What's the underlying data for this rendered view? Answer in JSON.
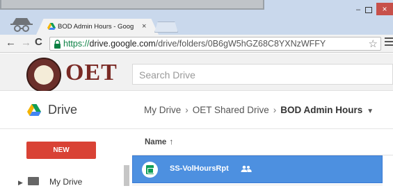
{
  "browser": {
    "tab_title": "BOD Admin Hours - Goog",
    "tab_close": "×",
    "window_min": "–",
    "window_close": "×",
    "url_scheme": "https://",
    "url_host": "drive.google.com",
    "url_path": "/drive/folders/0B6gW5hGZ68C8YXNzWFFY",
    "star": "☆"
  },
  "drive": {
    "logo_text": "OET",
    "search_placeholder": "Search Drive",
    "app_label": "Drive",
    "breadcrumb": [
      "My Drive",
      "OET Shared Drive",
      "BOD Admin Hours"
    ],
    "breadcrumb_sep": "›",
    "new_button": "NEW",
    "sidebar_items": [
      {
        "label": "My Drive"
      }
    ],
    "column_header": "Name",
    "sort_arrow": "↑",
    "files": [
      {
        "name": "SS-VolHoursRpt",
        "shared": true
      }
    ]
  },
  "colors": {
    "new_button": "#d94235",
    "selected_row": "#4d90e0",
    "sheets_green": "#0f9d58",
    "drive_yellow": "#f4b400",
    "drive_blue": "#4285f4",
    "drive_green": "#0f9d58"
  }
}
